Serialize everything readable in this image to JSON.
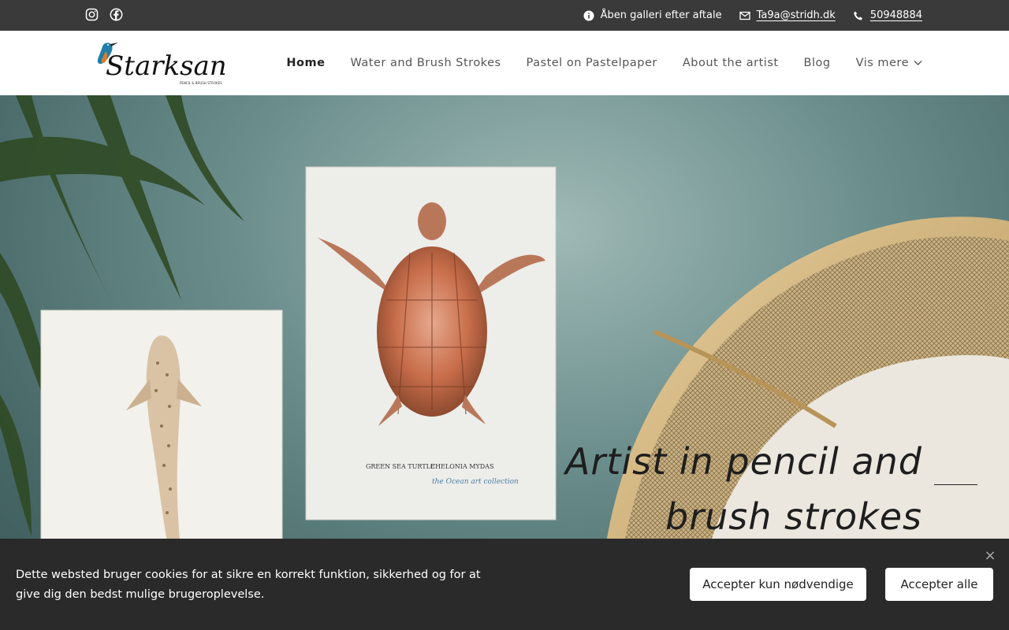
{
  "topbar": {
    "social": [
      {
        "icon": "instagram-icon"
      },
      {
        "icon": "facebook-icon"
      }
    ],
    "info_text": "Åben galleri efter aftale",
    "email": "Ta9a@stridh.dk",
    "phone": "50948884"
  },
  "header": {
    "logo_text": "Starksant",
    "logo_subtext": "PENCIL & BRUSH STROKES",
    "nav": [
      {
        "label": "Home",
        "active": true
      },
      {
        "label": "Water and Brush Strokes"
      },
      {
        "label": "Pastel on Pastelpaper"
      },
      {
        "label": "About the artist"
      },
      {
        "label": "Blog"
      },
      {
        "label": "Vis mere"
      }
    ]
  },
  "hero": {
    "headline": "Artist in pencil and brush strokes",
    "art_caption_left": "GREEN SEA TURTLE",
    "art_caption_right": "CHELONIA MYDAS",
    "art_signature": "the Ocean art collection"
  },
  "cookie": {
    "text": "Dette websted bruger cookies for at sikre en korrekt funktion, sikkerhed og for at give dig den bedst mulige brugeroplevelse.",
    "btn_necessary": "Accepter kun nødvendige",
    "btn_all": "Accepter alle",
    "close": "×"
  },
  "colors": {
    "topbar": "#3a3a3a",
    "cookie_bg": "#2a2a2a",
    "wall": "#6c8f8d"
  }
}
